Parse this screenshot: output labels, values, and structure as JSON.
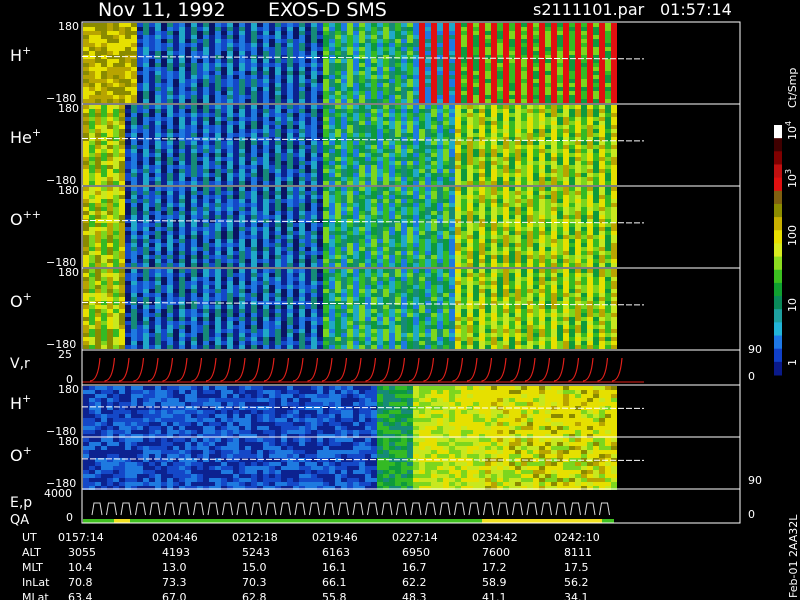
{
  "header": {
    "date": "Nov 11, 1992",
    "instrument": "EXOS-D SMS",
    "file": "s2111101.par",
    "time": "01:57:14"
  },
  "colorbar": {
    "unit": "Ct/Smp",
    "ticks": [
      "1",
      "10",
      "100",
      "10",
      "10"
    ],
    "tick_exponents": [
      "",
      "",
      "",
      "3",
      "4"
    ],
    "colors": [
      "#0a1a8a",
      "#1040c8",
      "#1e78e6",
      "#22b4d8",
      "#1ea0a0",
      "#0a8a5a",
      "#10a030",
      "#3cc020",
      "#8cdc20",
      "#d8ec20",
      "#e8e000",
      "#c8b000",
      "#8c8c00",
      "#806010",
      "#e01010",
      "#c01010",
      "#800000",
      "#400000",
      "#ffffff"
    ]
  },
  "footer": {
    "rev_label": "Feb-01 2AA32L"
  },
  "chart_data": {
    "type": "heatmap",
    "x_axis": {
      "UT": [
        "0157:14",
        "0204:46",
        "0212:18",
        "0219:46",
        "0227:14",
        "0234:42",
        "0242:10"
      ],
      "ALT": [
        "3055",
        "4193",
        "5243",
        "6163",
        "6950",
        "7600",
        "8111"
      ],
      "MLT": [
        "10.4",
        "13.0",
        "15.0",
        "16.1",
        "16.7",
        "17.2",
        "17.5"
      ],
      "InLat": [
        "70.8",
        "73.3",
        "70.3",
        "66.1",
        "62.2",
        "58.9",
        "56.2"
      ],
      "MLat": [
        "63.4",
        "67.0",
        "62.8",
        "55.8",
        "48.3",
        "41.1",
        "34.1"
      ]
    },
    "row_labels": [
      "UT",
      "ALT",
      "MLT",
      "InLat",
      "MLat"
    ],
    "panels": [
      {
        "id": "h-plus-1",
        "label": "H",
        "sup": "+",
        "ymax": "180",
        "ymin": "−180"
      },
      {
        "id": "he-plus",
        "label": "He",
        "sup": "+",
        "ymax": "180",
        "ymin": "−180"
      },
      {
        "id": "o-plus-plus",
        "label": "O",
        "sup": "++",
        "ymax": "180",
        "ymin": "−180"
      },
      {
        "id": "o-plus-1",
        "label": "O",
        "sup": "+",
        "ymax": "180",
        "ymin": "−180"
      },
      {
        "id": "vr",
        "label": "V,r",
        "sup": "",
        "ymax": "25",
        "ymin": "0",
        "right_top": "90",
        "right_bottom": "0"
      },
      {
        "id": "h-plus-2",
        "label": "H",
        "sup": "+",
        "ymax": "180",
        "ymin": "−180"
      },
      {
        "id": "o-plus-2",
        "label": "O",
        "sup": "+",
        "ymax": "180",
        "ymin": "−180",
        "right_bottom": "90"
      },
      {
        "id": "ep-qa",
        "label": "E,p",
        "label2": "QA",
        "sup": "",
        "ymax": "4000",
        "ymin": "0",
        "right_bottom": "0"
      }
    ],
    "colorbar_scale": "log",
    "colorbar_range": [
      1,
      10000
    ]
  }
}
